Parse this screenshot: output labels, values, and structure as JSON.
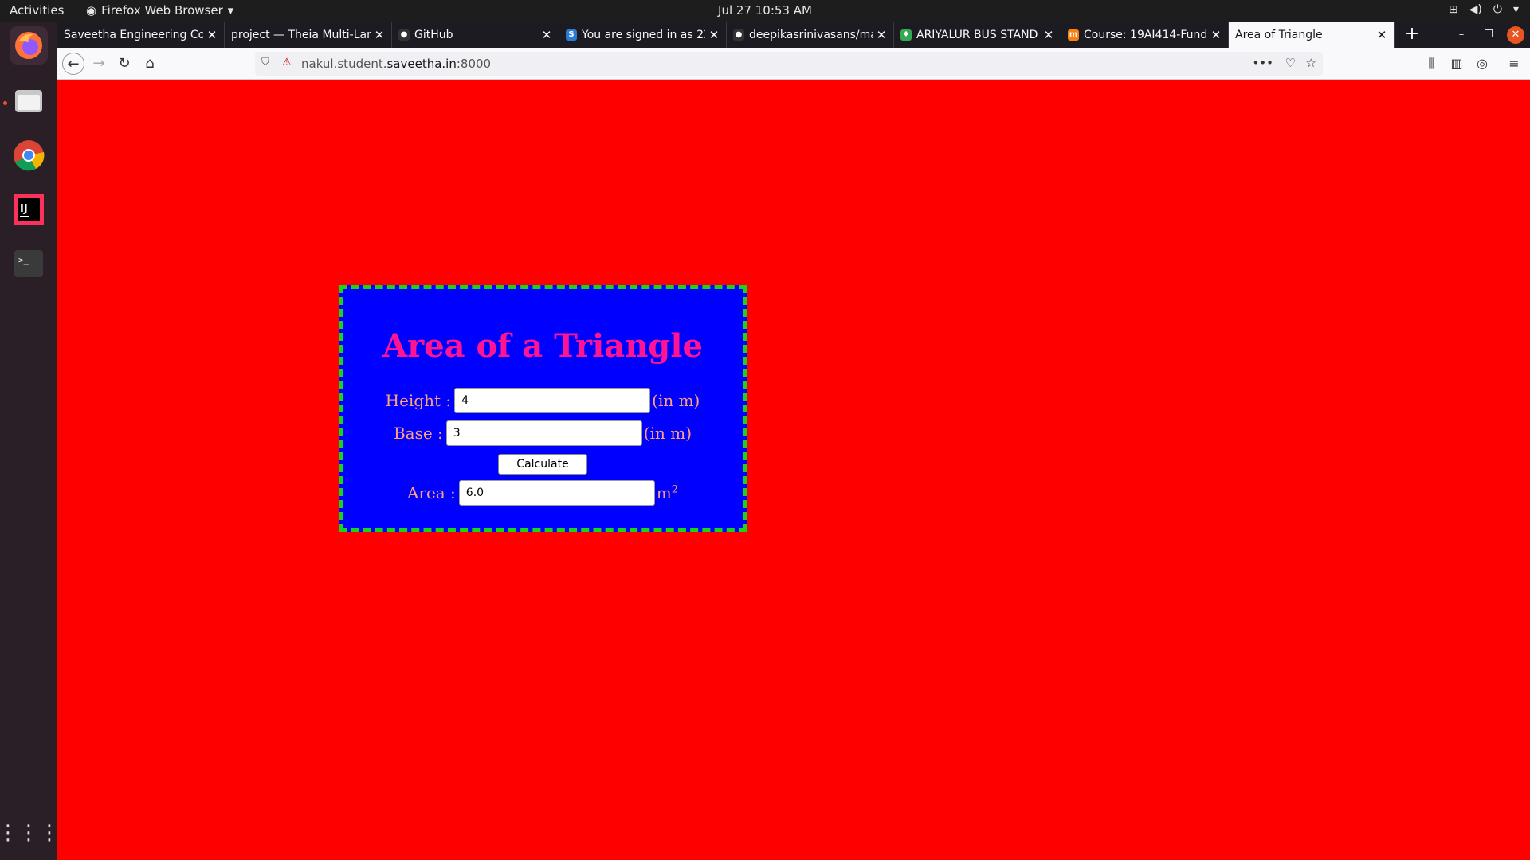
{
  "topbar": {
    "activities": "Activities",
    "app_name": "Firefox Web Browser",
    "clock": "Jul 27  10:53 AM"
  },
  "dock": {
    "apps": [
      "firefox-icon",
      "files-icon",
      "chrome-icon",
      "intellij-icon",
      "terminal-icon",
      "app-grid-icon"
    ]
  },
  "browser": {
    "tabs": [
      {
        "title": "Saveetha Engineering Col"
      },
      {
        "title": "project — Theia Multi-Lan"
      },
      {
        "title": "GitHub"
      },
      {
        "title": "You are signed in as 23"
      },
      {
        "title": "deepikasrinivasans/ma"
      },
      {
        "title": "ARIYALUR BUS STAND"
      },
      {
        "title": "Course: 19AI414-Fund"
      },
      {
        "title": "Area of Triangle"
      }
    ],
    "url_prefix": "nakul.student.",
    "url_domain": "saveetha.in",
    "url_suffix": ":8000"
  },
  "page": {
    "heading": "Area of a Triangle",
    "height_label": "Height :",
    "height_value": "4",
    "height_unit": "(in m)",
    "base_label": "Base :",
    "base_value": "3",
    "base_unit": "(in m)",
    "calculate_label": "Calculate",
    "area_label": "Area :",
    "area_value": "6.0",
    "area_unit": "m",
    "area_unit_sup": "2"
  },
  "colors": {
    "page_bg": "#ff0000",
    "form_bg": "#0000ff",
    "form_border": "#19d519",
    "heading": "#ff1493",
    "label": "#ffa07a"
  }
}
